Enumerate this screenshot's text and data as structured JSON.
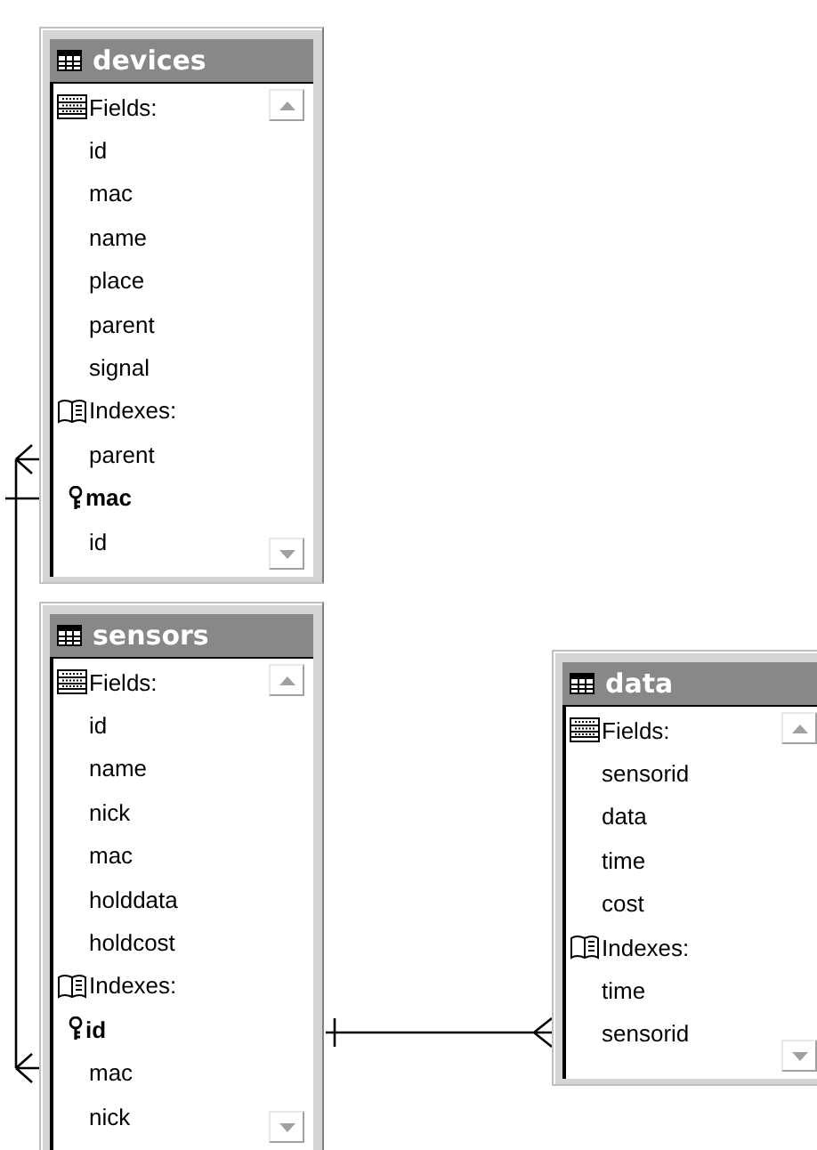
{
  "tables": [
    {
      "title": "devices",
      "fields_label": "Fields:",
      "fields": [
        "id",
        "mac",
        "name",
        "place",
        "parent",
        "signal"
      ],
      "indexes_label": "Indexes:",
      "indexes": [
        {
          "name": "parent",
          "primary": false
        },
        {
          "name": "mac",
          "primary": true
        },
        {
          "name": "id",
          "primary": false
        }
      ]
    },
    {
      "title": "sensors",
      "fields_label": "Fields:",
      "fields": [
        "id",
        "name",
        "nick",
        "mac",
        "holddata",
        "holdcost"
      ],
      "indexes_label": "Indexes:",
      "indexes": [
        {
          "name": "id",
          "primary": true
        },
        {
          "name": "mac",
          "primary": false
        },
        {
          "name": "nick",
          "primary": false
        }
      ]
    },
    {
      "title": "data",
      "fields_label": "Fields:",
      "fields": [
        "sensorid",
        "data",
        "time",
        "cost"
      ],
      "indexes_label": "Indexes:",
      "indexes": [
        {
          "name": "time",
          "primary": false
        },
        {
          "name": "sensorid",
          "primary": false
        }
      ]
    }
  ]
}
